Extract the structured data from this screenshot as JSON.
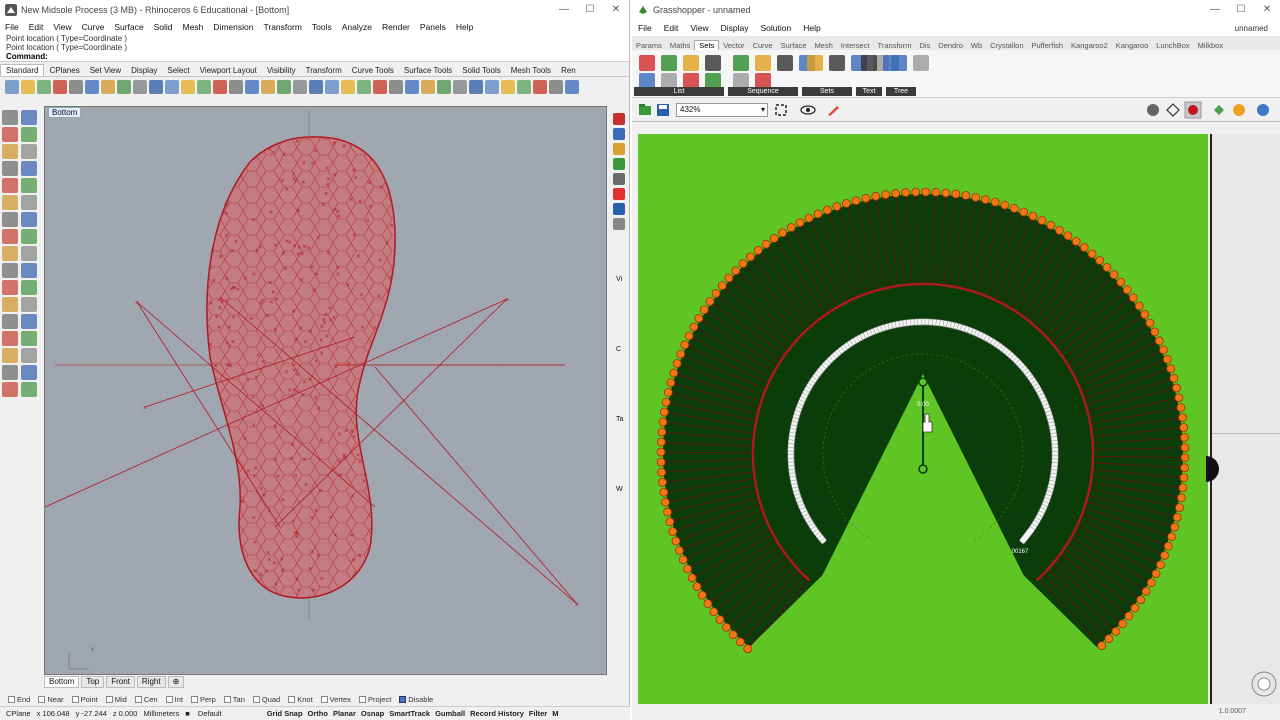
{
  "rhino": {
    "title": "New Midsole Process (3 MB) - Rhinoceros 6 Educational - [Bottom]",
    "menu": [
      "File",
      "Edit",
      "View",
      "Curve",
      "Surface",
      "Solid",
      "Mesh",
      "Dimension",
      "Transform",
      "Tools",
      "Analyze",
      "Render",
      "Panels",
      "Help"
    ],
    "history": [
      "Point location ( Type=Coordinate )",
      "Point location ( Type=Coordinate )"
    ],
    "command_label": "Command:",
    "toolbar_tabs": [
      "Standard",
      "CPlanes",
      "Set View",
      "Display",
      "Select",
      "Viewport Layout",
      "Visibility",
      "Transform",
      "Curve Tools",
      "Surface Tools",
      "Solid Tools",
      "Mesh Tools",
      "Ren"
    ],
    "viewport_title": "Bottom",
    "viewport_tabs": [
      "Bottom",
      "Top",
      "Front",
      "Right"
    ],
    "osnaps": [
      {
        "label": "End",
        "on": false
      },
      {
        "label": "Near",
        "on": false
      },
      {
        "label": "Point",
        "on": false
      },
      {
        "label": "Mid",
        "on": false
      },
      {
        "label": "Cen",
        "on": false
      },
      {
        "label": "Int",
        "on": false
      },
      {
        "label": "Perp",
        "on": false
      },
      {
        "label": "Tan",
        "on": false
      },
      {
        "label": "Quad",
        "on": false
      },
      {
        "label": "Knot",
        "on": false
      },
      {
        "label": "Vertex",
        "on": false
      },
      {
        "label": "Project",
        "on": false
      },
      {
        "label": "Disable",
        "on": true
      }
    ],
    "status": {
      "cplane": "CPlane",
      "x": "x 106.048",
      "y": "y -27.244",
      "z": "z 0.000",
      "units": "Millimeters",
      "layer": "Default",
      "toggles": [
        "Grid Snap",
        "Ortho",
        "Planar",
        "Osnap",
        "SmartTrack",
        "Gumball",
        "Record History",
        "Filter",
        "M"
      ]
    },
    "side_letters": [
      "Vi",
      "C",
      "Ta",
      "W"
    ],
    "win_buttons": [
      "—",
      "☐",
      "✕"
    ]
  },
  "grasshopper": {
    "title": "Grasshopper - unnamed",
    "menu": [
      "File",
      "Edit",
      "View",
      "Display",
      "Solution",
      "Help"
    ],
    "doc_name": "unnamed",
    "tabs": [
      "Params",
      "Maths",
      "Sets",
      "Vector",
      "Curve",
      "Surface",
      "Mesh",
      "Intersect",
      "Transform",
      "Dis",
      "Dendro",
      "Wb",
      "Crystallon",
      "Pufferfish",
      "Kangaroo2",
      "Kangaroo",
      "LunchBox",
      "Milkbox"
    ],
    "active_tab": "Sets",
    "groups": [
      "List",
      "Sequence",
      "Sets",
      "Text",
      "Tree"
    ],
    "zoom": "432%",
    "slider_label": "0.00",
    "label_right": "00167",
    "version": "1.0.0007",
    "win_buttons": [
      "—",
      "☐",
      "✕"
    ]
  },
  "colors": {
    "gh_canvas": "#5fc525",
    "dark_green": "#0a3d0a",
    "rhino_red": "#b01820",
    "orange": "#f07814",
    "viewport_bg": "#9fa6b0"
  }
}
